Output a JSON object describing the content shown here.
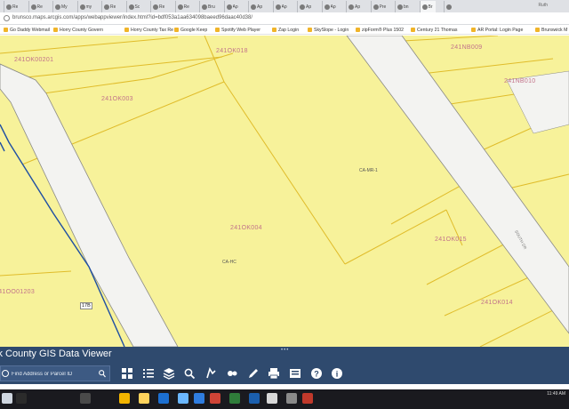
{
  "browser": {
    "tabs": [
      {
        "label": "Re"
      },
      {
        "label": "Re"
      },
      {
        "label": "My"
      },
      {
        "label": "my"
      },
      {
        "label": "Re"
      },
      {
        "label": "Sc"
      },
      {
        "label": "Re"
      },
      {
        "label": "Re"
      },
      {
        "label": "Bru"
      },
      {
        "label": "Ap"
      },
      {
        "label": "Ap"
      },
      {
        "label": "Ap"
      },
      {
        "label": "Ap"
      },
      {
        "label": "Ap"
      },
      {
        "label": "Ap"
      },
      {
        "label": "Pre"
      },
      {
        "label": "bn"
      },
      {
        "label": "Br"
      },
      {
        "label": ""
      }
    ],
    "user": "Ruth",
    "url": "brunsco.maps.arcgis.com/apps/webappviewer/index.html?id=bdf053a1aa634098baeed96daac40d38/",
    "bookmarks": [
      {
        "label": "Go Daddy Webmail"
      },
      {
        "label": "Horry County Govern"
      },
      {
        "label": "Horry County Tax Re"
      },
      {
        "label": "Google Keep"
      },
      {
        "label": "Spotify Web Player"
      },
      {
        "label": "Zap Login"
      },
      {
        "label": "SkySlope - Login"
      },
      {
        "label": "zipForm® Plus 1502"
      },
      {
        "label": "Century 21 Thomas"
      },
      {
        "label": "AR Portal: Login Page"
      },
      {
        "label": "Brunswick M"
      }
    ]
  },
  "map": {
    "parcels": [
      {
        "id": "241OK00201"
      },
      {
        "id": "241OK018"
      },
      {
        "id": "241OK003"
      },
      {
        "id": "241NB009"
      },
      {
        "id": "241NB010"
      },
      {
        "id": "241OK004"
      },
      {
        "id": "241OK015"
      },
      {
        "id": "241OK014"
      },
      {
        "id": "241OO01203"
      }
    ],
    "zones": [
      {
        "code": "CA-MR-1"
      },
      {
        "code": "CA-HC"
      }
    ],
    "road_name": "SOUTH DR",
    "highway_shield": "17B"
  },
  "app": {
    "title": "ck County GIS Data Viewer",
    "search_placeholder": "Find Address or Parcel ID",
    "tools": [
      {
        "icon": "basemap-gallery-icon"
      },
      {
        "icon": "legend-icon"
      },
      {
        "icon": "layers-icon"
      },
      {
        "icon": "query-icon"
      },
      {
        "icon": "identify-icon"
      },
      {
        "icon": "attribute-icon"
      },
      {
        "icon": "draw-icon"
      },
      {
        "icon": "print-icon"
      },
      {
        "icon": "add-data-icon"
      },
      {
        "icon": "help-icon"
      },
      {
        "icon": "about-icon"
      }
    ]
  },
  "taskbar": {
    "time": "11:49 AM"
  },
  "colors": {
    "map_fill": "#f7f29a",
    "parcel_line": "#e0bc2a",
    "road_fill": "#f3f3f1",
    "road_edge": "#8a8a86",
    "highway_line": "#1f4fa3",
    "toolbar_bg": "#2f4a6e"
  }
}
